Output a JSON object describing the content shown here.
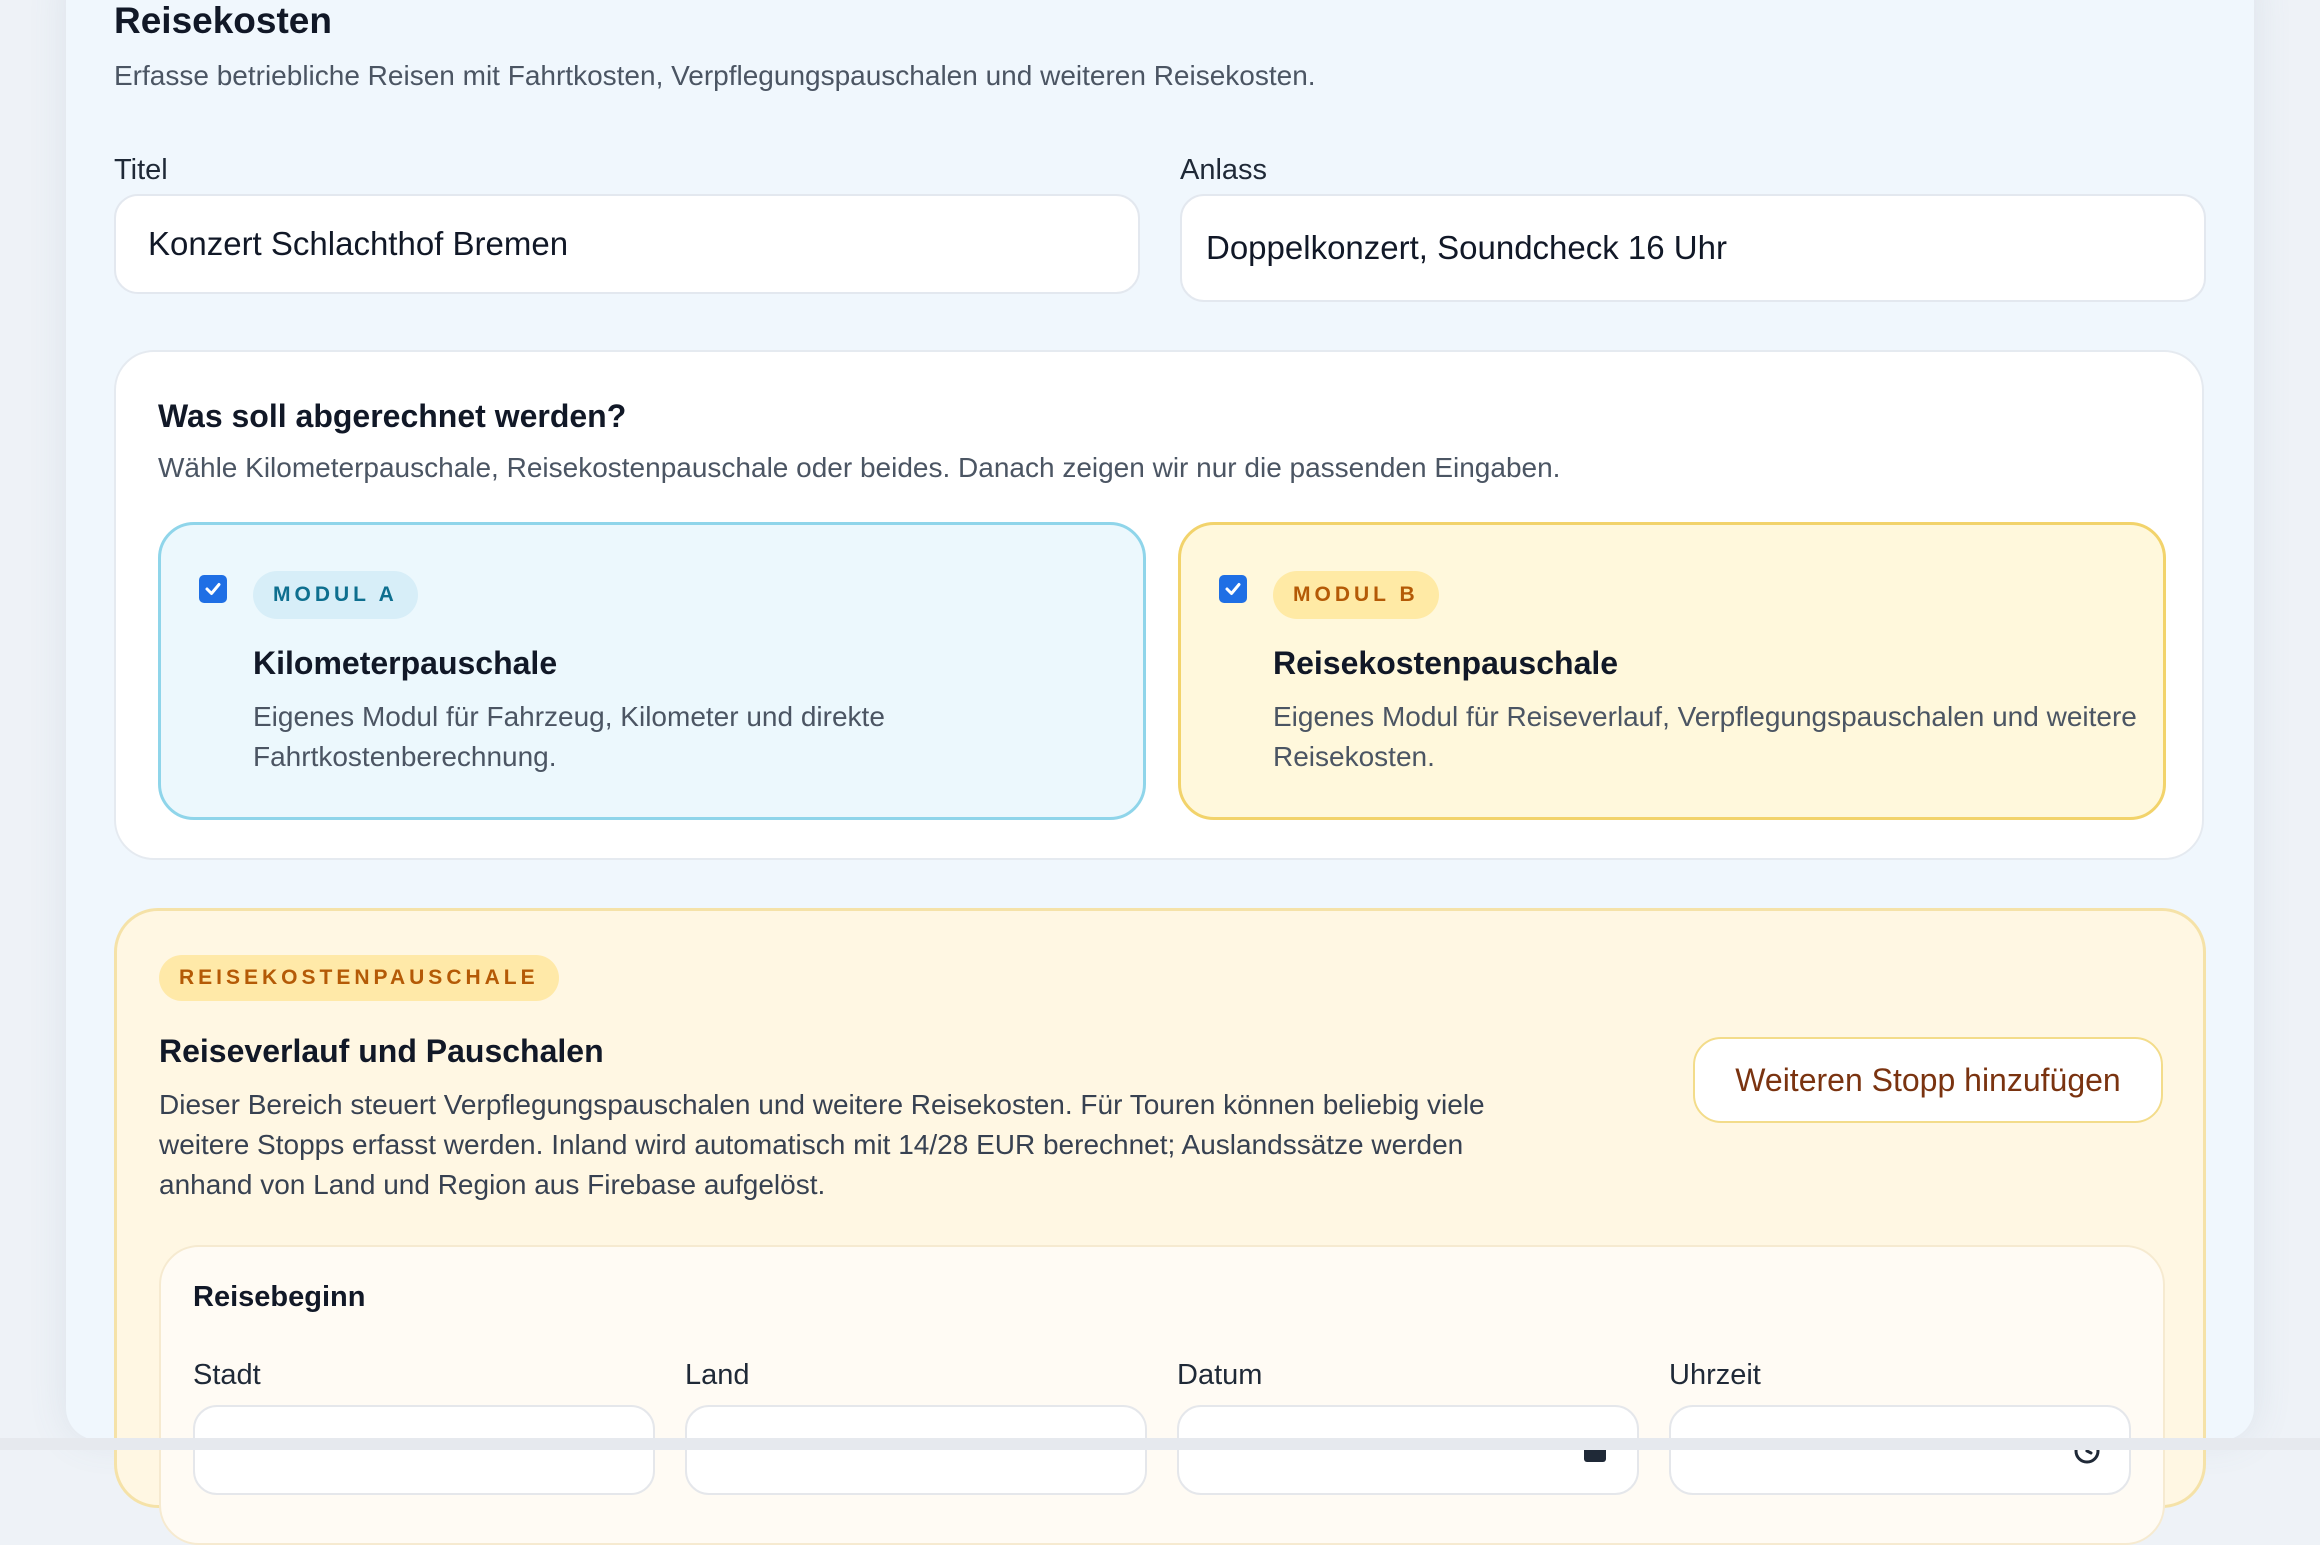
{
  "header": {
    "title": "Reisekosten",
    "subtitle": "Erfasse betriebliche Reisen mit Fahrtkosten, Verpflegungspauschalen und weiteren Reisekosten."
  },
  "fields": {
    "title_label": "Titel",
    "title_value": "Konzert Schlachthof Bremen",
    "occasion_label": "Anlass",
    "occasion_value": "Doppelkonzert, Soundcheck 16 Uhr"
  },
  "billing": {
    "title": "Was soll abgerechnet werden?",
    "subtitle": "Wähle Kilometerpauschale, Reisekostenpauschale oder beides. Danach zeigen wir nur die passenden Eingaben.",
    "modules": [
      {
        "badge": "MODUL A",
        "title": "Kilometerpauschale",
        "description": "Eigenes Modul für Fahrzeug, Kilometer und direkte Fahrtkostenberechnung.",
        "checked": true
      },
      {
        "badge": "MODUL B",
        "title": "Reisekostenpauschale",
        "description": "Eigenes Modul für Reiseverlauf, Verpflegungspauschalen und weitere Reisekosten.",
        "checked": true
      }
    ]
  },
  "travel_section": {
    "badge": "REISEKOSTENPAUSCHALE",
    "title": "Reiseverlauf und Pauschalen",
    "description": "Dieser Bereich steuert Verpflegungspauschalen und weitere Reisekosten. Für Touren können beliebig viele weitere Stopps erfasst werden. Inland wird automatisch mit 14/28 EUR berechnet; Auslandssätze werden anhand von Land und Region aus Firebase aufgelöst.",
    "add_stop_label": "Weiteren Stopp hinzufügen",
    "start": {
      "title": "Reisebeginn",
      "city_label": "Stadt",
      "country_label": "Land",
      "date_label": "Datum",
      "time_label": "Uhrzeit",
      "date_icon": "calendar-icon",
      "time_icon": "clock-icon"
    }
  },
  "colors": {
    "module_a_border": "#8fd5ea",
    "module_b_border": "#f2d36b",
    "checkbox": "#1f6fe5",
    "accent_brown": "#7a3310"
  }
}
